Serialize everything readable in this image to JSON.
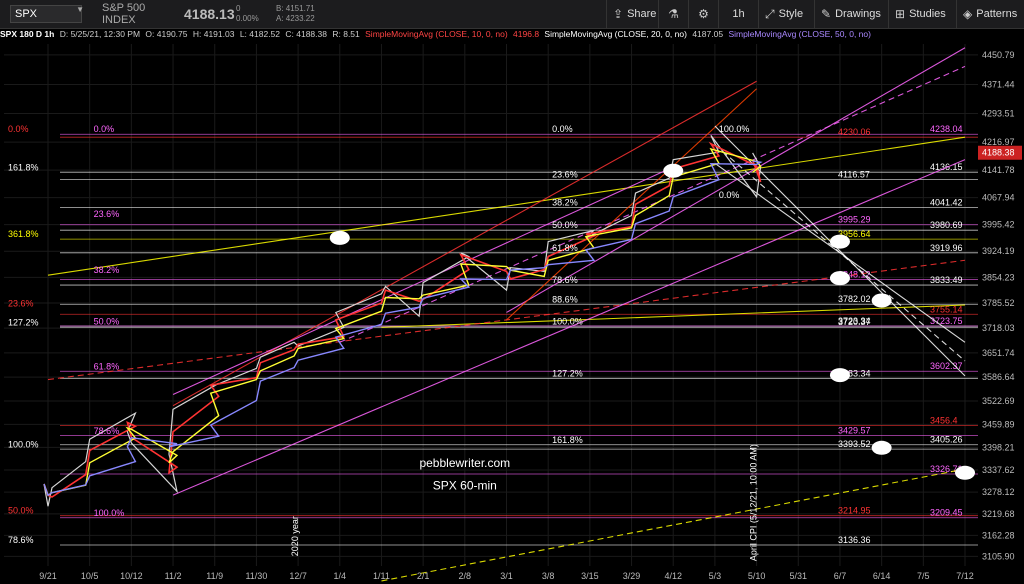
{
  "toolbar": {
    "symbol": "SPX",
    "name": "S&P 500 INDEX",
    "last": "4188.13",
    "change": "0",
    "change_pct": "0.00%",
    "bid": "B: 4151.71",
    "ask": "A: 4233.22",
    "share": "Share",
    "interval": "1h",
    "style": "Style",
    "drawings": "Drawings",
    "studies": "Studies",
    "patterns": "Patterns"
  },
  "legend": {
    "title": "SPX 180 D 1h",
    "date": "D: 5/25/21, 12:30 PM",
    "open": "O: 4190.75",
    "high": "H: 4191.03",
    "low": "L: 4182.52",
    "close": "C: 4188.38",
    "range": "R: 8.51",
    "sma10": "SimpleMovingAvg (CLOSE, 10, 0, no)",
    "sma10_val": "4196.8",
    "sma20": "SimpleMovingAvg (CLOSE, 20, 0, no)",
    "sma20_val": "4187.05",
    "sma50": "SimpleMovingAvg (CLOSE, 50, 0, no)"
  },
  "chart_data": {
    "type": "candlestick",
    "symbol": "SPX",
    "interval": "60-min",
    "ylim": [
      3080,
      4480
    ],
    "y_ticks": [
      4450.79,
      4371.44,
      4293.51,
      4216.97,
      4141.78,
      4067.94,
      3995.42,
      3924.19,
      3854.23,
      3785.52,
      3718.03,
      3651.74,
      3586.64,
      3522.69,
      3459.89,
      3398.21,
      3337.62,
      3278.12,
      3219.68,
      3162.28,
      3105.9
    ],
    "x_ticks": [
      "9/21",
      "10/5",
      "10/12",
      "11/2",
      "11/9",
      "11/30",
      "12/7",
      "1/4",
      "1/11",
      "2/1",
      "2/8",
      "3/1",
      "3/8",
      "3/15",
      "3/29",
      "4/12",
      "5/3",
      "5/10",
      "5/31",
      "6/7",
      "6/14",
      "7/5",
      "7/12"
    ],
    "last_price": "4188.38",
    "price_path": [
      [
        "9/21",
        3300
      ],
      [
        "9/21",
        3240
      ],
      [
        "9/21",
        3290
      ],
      [
        "10/5",
        3360
      ],
      [
        "10/5",
        3420
      ],
      [
        "10/12",
        3490
      ],
      [
        "10/12",
        3440
      ],
      [
        "10/12",
        3410
      ],
      [
        "11/2",
        3280
      ],
      [
        "11/2",
        3380
      ],
      [
        "11/2",
        3500
      ],
      [
        "11/9",
        3570
      ],
      [
        "11/9",
        3560
      ],
      [
        "11/30",
        3610
      ],
      [
        "11/30",
        3640
      ],
      [
        "12/7",
        3680
      ],
      [
        "12/7",
        3670
      ],
      [
        "1/4",
        3720
      ],
      [
        "1/4",
        3760
      ],
      [
        "1/11",
        3810
      ],
      [
        "1/11",
        3830
      ],
      [
        "2/1",
        3750
      ],
      [
        "2/1",
        3840
      ],
      [
        "2/8",
        3910
      ],
      [
        "2/8",
        3920
      ],
      [
        "3/1",
        3820
      ],
      [
        "3/1",
        3880
      ],
      [
        "3/8",
        3870
      ],
      [
        "3/8",
        3950
      ],
      [
        "3/15",
        3980
      ],
      [
        "3/15",
        3960
      ],
      [
        "3/29",
        4020
      ],
      [
        "3/29",
        4080
      ],
      [
        "4/12",
        4120
      ],
      [
        "4/12",
        4170
      ],
      [
        "5/3",
        4190
      ],
      [
        "5/3",
        4235
      ],
      [
        "5/10",
        4070
      ],
      [
        "5/10",
        4150
      ],
      [
        "5/10",
        4188
      ]
    ],
    "price_levels": [
      {
        "value": 4238.04,
        "color": "#ff66ff",
        "label": "4238.04"
      },
      {
        "value": 4230.06,
        "color": "#ff3333",
        "label": "4230.06"
      },
      {
        "value": 4136.15,
        "color": "#ffffff",
        "label": "4136.15"
      },
      {
        "value": 4116.57,
        "color": "#ffffff",
        "label": "4116.57"
      },
      {
        "value": 4041.42,
        "color": "#ffffff",
        "label": "4041.42"
      },
      {
        "value": 3995.29,
        "color": "#ff66ff",
        "label": "3995.29"
      },
      {
        "value": 3980.69,
        "color": "#ffffff",
        "label": "3980.69"
      },
      {
        "value": 3956.64,
        "color": "#ffff00",
        "label": "3956.64"
      },
      {
        "value": 3919.96,
        "color": "#ffffff",
        "label": "3919.96"
      },
      {
        "value": 3848.12,
        "color": "#ff66ff",
        "label": "3848.12"
      },
      {
        "value": 3833.49,
        "color": "#ffffff",
        "label": "3833.49"
      },
      {
        "value": 3782.02,
        "color": "#ffffff",
        "label": "3782.02"
      },
      {
        "value": 3755.14,
        "color": "#ff3333",
        "label": "3755.14"
      },
      {
        "value": 3723.34,
        "color": "#ffffff",
        "label": "3723.34"
      },
      {
        "value": 3723.75,
        "color": "#ff66ff",
        "label": "3723.75"
      },
      {
        "value": 3720.37,
        "color": "#ffffff",
        "label": "3720.37"
      },
      {
        "value": 3602.37,
        "color": "#ff66ff",
        "label": "3602.37"
      },
      {
        "value": 3583.34,
        "color": "#ffffff",
        "label": "3583.34"
      },
      {
        "value": 3456.4,
        "color": "#ff3333",
        "label": "3456.4"
      },
      {
        "value": 3429.57,
        "color": "#ff66ff",
        "label": "3429.57"
      },
      {
        "value": 3405.26,
        "color": "#ffffff",
        "label": "3405.26"
      },
      {
        "value": 3393.52,
        "color": "#ffffff",
        "label": "3393.52"
      },
      {
        "value": 3326.71,
        "color": "#ff66ff",
        "label": "3326.71"
      },
      {
        "value": 3214.95,
        "color": "#ff3333",
        "label": "3214.95"
      },
      {
        "value": 3209.45,
        "color": "#ff66ff",
        "label": "3209.45"
      },
      {
        "value": 3136.36,
        "color": "#ffffff",
        "label": "3136.36"
      }
    ],
    "fib_labels": [
      {
        "text": "0.0%",
        "color": "#ff3333",
        "x": "9/21",
        "y": 4238
      },
      {
        "text": "0.0%",
        "color": "#ff66ff",
        "x": "10/5",
        "y": 4238
      },
      {
        "text": "161.8%",
        "color": "#ffffff",
        "x": "9/21",
        "y": 4136
      },
      {
        "text": "23.6%",
        "color": "#ff66ff",
        "x": "10/5",
        "y": 4010
      },
      {
        "text": "361.8%",
        "color": "#ffff00",
        "x": "9/21",
        "y": 3957
      },
      {
        "text": "38.2%",
        "color": "#ff66ff",
        "x": "10/5",
        "y": 3860
      },
      {
        "text": "23.6%",
        "color": "#ff3333",
        "x": "9/21",
        "y": 3770
      },
      {
        "text": "127.2%",
        "color": "#ffffff",
        "x": "9/21",
        "y": 3720
      },
      {
        "text": "50.0%",
        "color": "#ff66ff",
        "x": "10/5",
        "y": 3723
      },
      {
        "text": "61.8%",
        "color": "#ff66ff",
        "x": "10/5",
        "y": 3602
      },
      {
        "text": "78.6%",
        "color": "#ff66ff",
        "x": "10/5",
        "y": 3429
      },
      {
        "text": "100.0%",
        "color": "#ffffff",
        "x": "9/21",
        "y": 3393
      },
      {
        "text": "50.0%",
        "color": "#ff3333",
        "x": "9/21",
        "y": 3215
      },
      {
        "text": "100.0%",
        "color": "#ff66ff",
        "x": "10/5",
        "y": 3209
      },
      {
        "text": "78.6%",
        "color": "#ffffff",
        "x": "9/21",
        "y": 3136
      },
      {
        "text": "0.0%",
        "color": "#ffffff",
        "x": "3/8",
        "y": 4238
      },
      {
        "text": "23.6%",
        "color": "#ffffff",
        "x": "3/8",
        "y": 4116
      },
      {
        "text": "38.2%",
        "color": "#ffffff",
        "x": "3/8",
        "y": 4041
      },
      {
        "text": "50.0%",
        "color": "#ffffff",
        "x": "3/8",
        "y": 3981
      },
      {
        "text": "61.8%",
        "color": "#ffffff",
        "x": "3/8",
        "y": 3920
      },
      {
        "text": "78.6%",
        "color": "#ffffff",
        "x": "3/8",
        "y": 3833
      },
      {
        "text": "88.6%",
        "color": "#ffffff",
        "x": "3/8",
        "y": 3782
      },
      {
        "text": "100.0%",
        "color": "#ffffff",
        "x": "3/8",
        "y": 3723
      },
      {
        "text": "127.2%",
        "color": "#ffffff",
        "x": "3/8",
        "y": 3583
      },
      {
        "text": "161.8%",
        "color": "#ffffff",
        "x": "3/8",
        "y": 3405
      },
      {
        "text": "100.0%",
        "color": "#ffffff",
        "x": "5/3",
        "y": 4238
      },
      {
        "text": "0.0%",
        "color": "#ffffff",
        "x": "5/3",
        "y": 4061
      }
    ],
    "annotations": [
      {
        "text": "pebblewriter.com",
        "x": "2/8",
        "y": 3345
      },
      {
        "text": "SPX 60-min",
        "x": "2/8",
        "y": 3285
      },
      {
        "text": "April CPI (5/12/21, 10:00 AM)",
        "x": "5/10",
        "y": 3250,
        "rotate": -90
      },
      {
        "text": "2020 year",
        "x": "12/7",
        "y": 3160,
        "rotate": -90
      }
    ],
    "trendlines": [
      {
        "color": "#ffff00",
        "from": [
          "9/21",
          3860
        ],
        "to": [
          "7/12",
          4230
        ],
        "dash": false
      },
      {
        "color": "#ffff00",
        "from": [
          "1/11",
          3720
        ],
        "to": [
          "7/12",
          3780
        ],
        "dash": false
      },
      {
        "color": "#ffff00",
        "from": [
          "1/11",
          3040
        ],
        "to": [
          "7/12",
          3340
        ],
        "dash": true
      },
      {
        "color": "#ff3333",
        "from": [
          "9/21",
          3580
        ],
        "to": [
          "7/12",
          3900
        ],
        "dash": true
      },
      {
        "color": "#ff3333",
        "from": [
          "11/2",
          3510
        ],
        "to": [
          "5/10",
          4380
        ],
        "dash": false
      },
      {
        "color": "#ff66ff",
        "from": [
          "11/2",
          3540
        ],
        "to": [
          "4/12",
          4150
        ],
        "dash": false
      },
      {
        "color": "#ff66ff",
        "from": [
          "11/2",
          3270
        ],
        "to": [
          "7/12",
          4170
        ],
        "dash": false
      },
      {
        "color": "#ff66ff",
        "from": [
          "1/4",
          3680
        ],
        "to": [
          "7/12",
          4420
        ],
        "dash": true
      },
      {
        "color": "#ff66ff",
        "from": [
          "3/1",
          3760
        ],
        "to": [
          "7/12",
          4470
        ],
        "dash": false
      },
      {
        "color": "#ff4400",
        "from": [
          "3/1",
          3740
        ],
        "to": [
          "5/10",
          4360
        ],
        "dash": false
      },
      {
        "color": "#ffffff",
        "from": [
          "5/3",
          4260
        ],
        "to": [
          "7/12",
          3590
        ],
        "dash": false
      },
      {
        "color": "#ffffff",
        "from": [
          "5/3",
          4210
        ],
        "to": [
          "7/12",
          3630
        ],
        "dash": true
      },
      {
        "color": "#ffffff",
        "from": [
          "5/3",
          4160
        ],
        "to": [
          "7/12",
          3680
        ],
        "dash": false
      }
    ],
    "markers": [
      {
        "x": "1/4",
        "y": 3960
      },
      {
        "x": "4/12",
        "y": 4140
      },
      {
        "x": "6/7",
        "y": 3950
      },
      {
        "x": "6/7",
        "y": 3852
      },
      {
        "x": "6/14",
        "y": 3792
      },
      {
        "x": "6/7",
        "y": 3592
      },
      {
        "x": "6/14",
        "y": 3397
      },
      {
        "x": "7/12",
        "y": 3330
      }
    ],
    "grid": true
  }
}
